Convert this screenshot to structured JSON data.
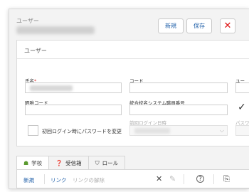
{
  "header": {
    "title": "ユーザー",
    "new_label": "新規",
    "save_label": "保存",
    "close_label": "✕"
  },
  "panel": {
    "title": "ユーザー",
    "fields": {
      "name_label": "氏名",
      "required_mark": "*",
      "code_label": "コード",
      "cut_label_1": "ユー",
      "login_code_label": "晒唯コード",
      "staff_no_label": "統合校名システム職員番号",
      "first_login_date_label": "前回ログイン日時",
      "cut_label_2": "パスワ",
      "password_change_label": "初回ログイン時にパスワードを変更"
    },
    "checkmark": "✓"
  },
  "tabs": [
    {
      "icon": "☗",
      "label": "学校"
    },
    {
      "icon": "❓",
      "label": "受信箱"
    },
    {
      "icon": "⛉",
      "label": "ロール"
    }
  ],
  "toolbar": {
    "new_label": "新規",
    "link_label": "リンク",
    "unlink_label": "リンクの解除",
    "delete_icon": "✕",
    "edit_icon": "✎",
    "help_icon": "?",
    "export_icon": "⎘"
  }
}
